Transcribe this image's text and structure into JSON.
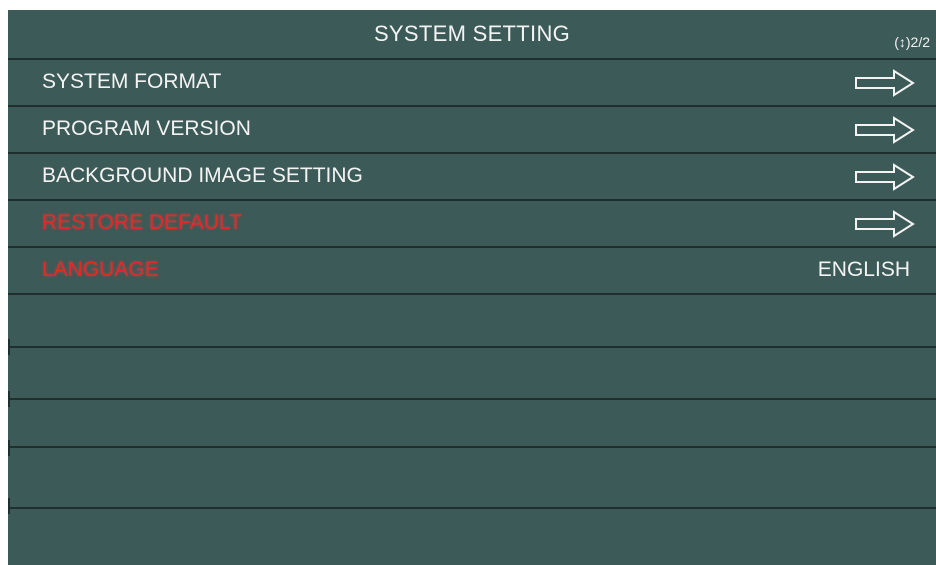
{
  "header": {
    "title": "SYSTEM SETTING",
    "page_indicator": "(↕)2/2"
  },
  "menu": {
    "items": [
      {
        "label": "SYSTEM FORMAT",
        "trailing": "arrow-right-icon",
        "color": "#f3f3f3"
      },
      {
        "label": "PROGRAM VERSION",
        "trailing": "arrow-right-icon",
        "color": "#f3f3f3"
      },
      {
        "label": "BACKGROUND IMAGE SETTING",
        "trailing": "arrow-right-icon",
        "color": "#f3f3f3"
      },
      {
        "label": "RESTORE DEFAULT",
        "trailing": "arrow-right-icon",
        "color": "#e32a2a"
      },
      {
        "label": "LANGUAGE",
        "value": "ENGLISH",
        "color": "#e32a2a"
      }
    ]
  },
  "colors": {
    "background": "#3c5a57",
    "divider": "#1f2f2e",
    "text": "#f3f3f3",
    "highlight": "#e32a2a"
  }
}
